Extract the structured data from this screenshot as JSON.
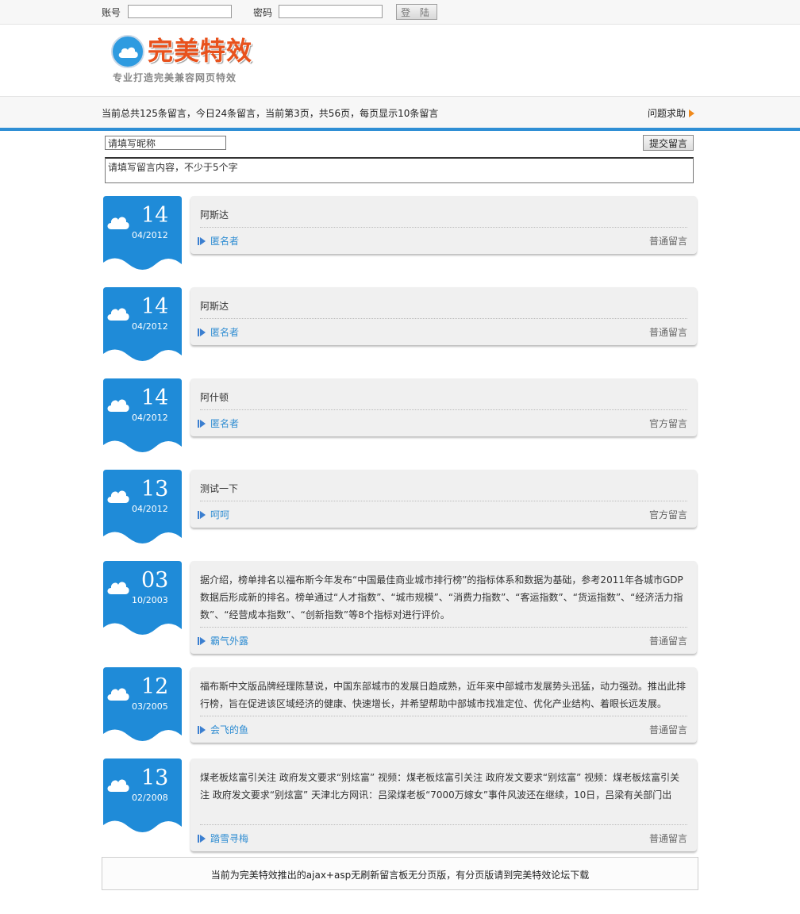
{
  "login": {
    "account_label": "账号",
    "account_value": "",
    "password_label": "密码",
    "password_value": "",
    "login_button": "登 陆"
  },
  "logo": {
    "title": "完美特效",
    "subtitle": "专业打造完美兼容网页特效"
  },
  "stats": {
    "text": "当前总共125条留言，今日24条留言，当前第3页，共56页，每页显示10条留言",
    "help_link": "问题求助"
  },
  "form": {
    "nickname_value": "请填写昵称",
    "content_value": "请填写留言内容，不少于5个字",
    "submit_label": "提交留言"
  },
  "messages": [
    {
      "day": "14",
      "month_year": "04/2012",
      "text": "阿斯达",
      "author": "匿名者",
      "type": "普通留言"
    },
    {
      "day": "14",
      "month_year": "04/2012",
      "text": "阿斯达",
      "author": "匿名者",
      "type": "普通留言"
    },
    {
      "day": "14",
      "month_year": "04/2012",
      "text": "阿什顿",
      "author": "匿名者",
      "type": "官方留言"
    },
    {
      "day": "13",
      "month_year": "04/2012",
      "text": "测试一下",
      "author": "呵呵",
      "type": "官方留言"
    },
    {
      "day": "03",
      "month_year": "10/2003",
      "text": "据介绍，榜单排名以福布斯今年发布“中国最佳商业城市排行榜”的指标体系和数据为基础，参考2011年各城市GDP数据后形成新的排名。榜单通过“人才指数”、“城市规模”、“消费力指数”、“客运指数”、“货运指数”、“经济活力指数”、“经营成本指数”、“创新指数”等8个指标对进行评价。",
      "author": "霸气外露",
      "type": "普通留言"
    },
    {
      "day": "12",
      "month_year": "03/2005",
      "text": "福布斯中文版品牌经理陈慧说，中国东部城市的发展日趋成熟，近年来中部城市发展势头迅猛，动力强劲。推出此排行榜，旨在促进该区域经济的健康、快速增长，并希望帮助中部城市找准定位、优化产业结构、着眼长远发展。",
      "author": "会飞的鱼",
      "type": "普通留言"
    },
    {
      "day": "13",
      "month_year": "02/2008",
      "text": "煤老板炫富引关注 政府发文要求“别炫富” 视频：煤老板炫富引关注 政府发文要求“别炫富” 视频：煤老板炫富引关注 政府发文要求“别炫富” 天津北方网讯：吕梁煤老板“7000万嫁女”事件风波还在继续，10日，吕梁有关部门出",
      "author": "踏雪寻梅",
      "type": "普通留言"
    }
  ],
  "footer": {
    "text": "当前为完美特效推出的ajax+asp无刷新留言板无分页版，有分页版请到完美特效论坛下载"
  },
  "colors": {
    "accent_blue": "#2f8fd5",
    "date_blue": "#1f8bd8",
    "logo_orange": "#e8511c",
    "help_arrow": "#f08a1c"
  }
}
